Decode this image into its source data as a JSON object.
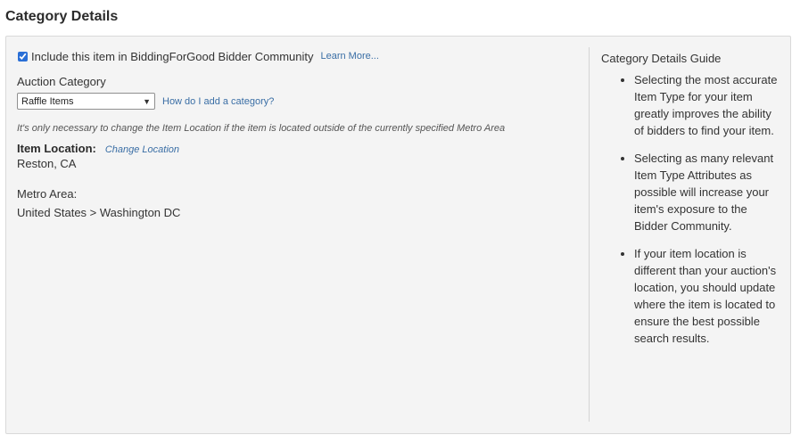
{
  "header": {
    "title": "Category Details"
  },
  "include": {
    "checked": true,
    "label": "Include this item in BiddingForGood Bidder Community",
    "learn_more": "Learn More..."
  },
  "auction_category": {
    "label": "Auction Category",
    "selected": "Raffle Items",
    "help_link": "How do I add a category?"
  },
  "location": {
    "note": "It's only necessary to change the Item Location if the item is located outside of the currently specified Metro Area",
    "label": "Item Location:",
    "change_link": "Change Location",
    "value": "Reston, CA"
  },
  "metro": {
    "label": "Metro Area:",
    "value": "United States > Washington DC"
  },
  "guide": {
    "title": "Category Details Guide",
    "items": [
      "Selecting the most accurate Item Type for your item greatly improves the ability of bidders to find your item.",
      "Selecting as many relevant Item Type Attributes as possible will increase your item's exposure to the Bidder Community.",
      "If your item location is different than your auction's location, you should update where the item is located to ensure the best possible search results."
    ]
  }
}
